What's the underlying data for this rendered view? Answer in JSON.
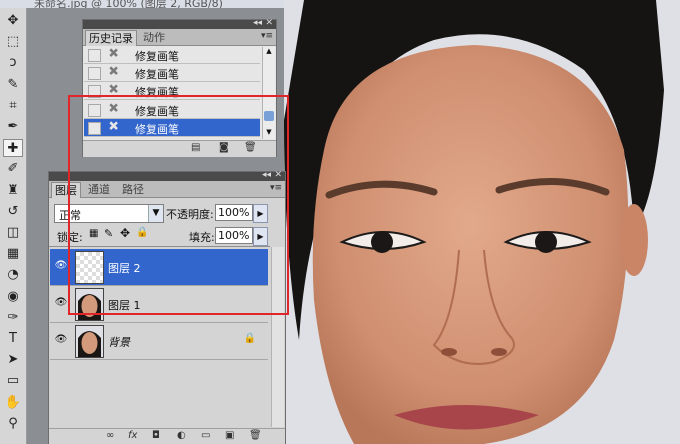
{
  "document": {
    "title": "未命名.jpg @ 100% (图层 2, RGB/8)"
  },
  "toolbar": {
    "tools": [
      {
        "name": "move-tool",
        "glyph": "✥"
      },
      {
        "name": "marquee-tool",
        "glyph": "⬚"
      },
      {
        "name": "lasso-tool",
        "glyph": "ↄ"
      },
      {
        "name": "quick-select-tool",
        "glyph": "✎"
      },
      {
        "name": "crop-tool",
        "glyph": "⌗"
      },
      {
        "name": "eyedropper-tool",
        "glyph": "✒"
      },
      {
        "name": "healing-brush-tool",
        "glyph": "✚"
      },
      {
        "name": "brush-tool",
        "glyph": "✐"
      },
      {
        "name": "clone-stamp-tool",
        "glyph": "♜"
      },
      {
        "name": "history-brush-tool",
        "glyph": "↺"
      },
      {
        "name": "eraser-tool",
        "glyph": "◫"
      },
      {
        "name": "gradient-tool",
        "glyph": "▦"
      },
      {
        "name": "blur-tool",
        "glyph": "◔"
      },
      {
        "name": "dodge-tool",
        "glyph": "◉"
      },
      {
        "name": "pen-tool",
        "glyph": "✑"
      },
      {
        "name": "type-tool",
        "glyph": "T"
      },
      {
        "name": "path-select-tool",
        "glyph": "➤"
      },
      {
        "name": "shape-tool",
        "glyph": "▭"
      },
      {
        "name": "hand-tool",
        "glyph": "✋"
      },
      {
        "name": "zoom-tool",
        "glyph": "⚲"
      }
    ]
  },
  "history_panel": {
    "tabs": [
      "历史记录",
      "动作"
    ],
    "items": [
      "修复画笔",
      "修复画笔",
      "修复画笔",
      "修复画笔",
      "修复画笔"
    ],
    "selected_index": 4
  },
  "layers_panel": {
    "tabs": [
      "图层",
      "通道",
      "路径"
    ],
    "blend_mode": "正常",
    "opacity_label": "不透明度:",
    "opacity_value": "100%",
    "lock_label": "锁定:",
    "fill_label": "填充:",
    "fill_value": "100%",
    "layers": [
      {
        "name": "图层 2",
        "selected": true
      },
      {
        "name": "图层 1",
        "selected": false
      },
      {
        "name": "背景",
        "selected": false
      }
    ]
  }
}
